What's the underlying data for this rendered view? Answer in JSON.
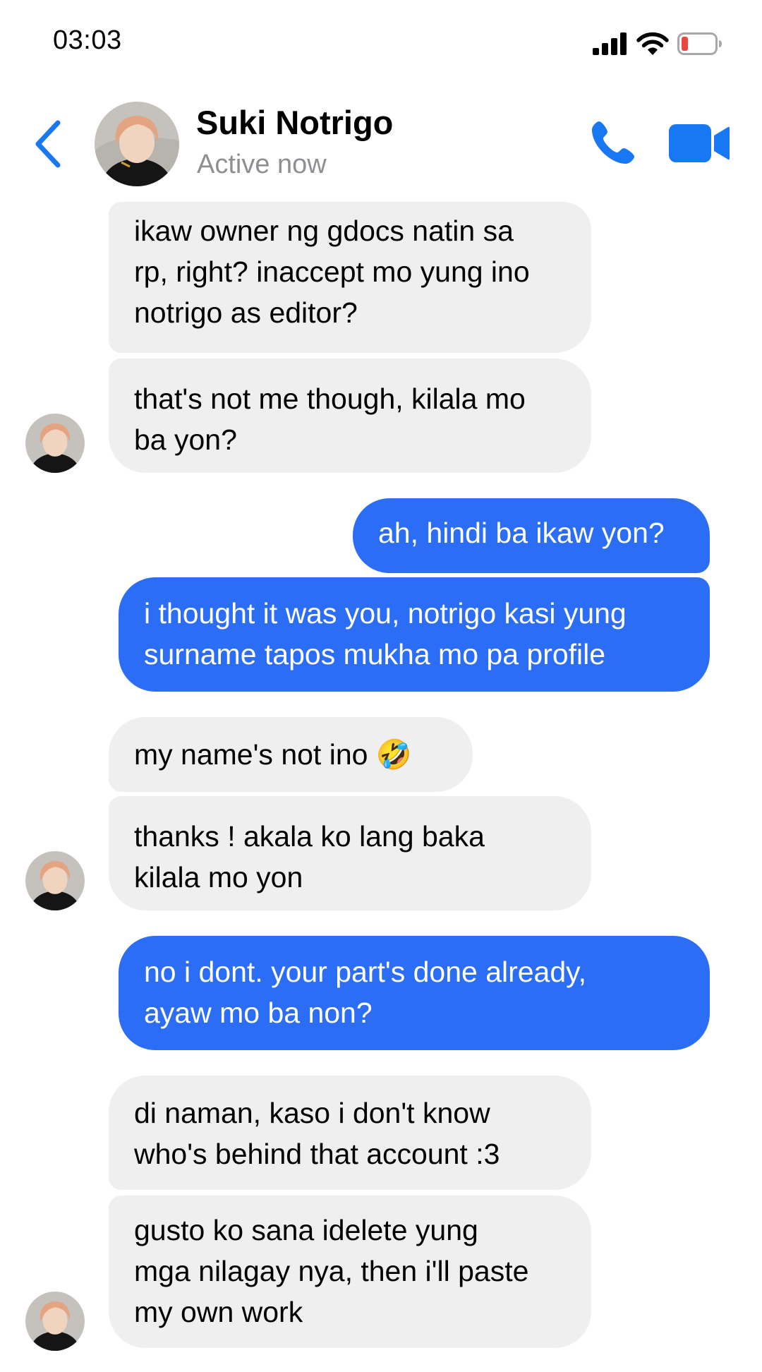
{
  "status_bar": {
    "time": "03:03",
    "icons": [
      "signal-icon",
      "wifi-icon",
      "battery-low-icon"
    ]
  },
  "header": {
    "back_icon": "chevron-left-icon",
    "contact_name": "Suki Notrigo",
    "contact_status": "Active now",
    "call_icon": "phone-icon",
    "video_icon": "video-camera-icon"
  },
  "colors": {
    "accent": "#1877F2",
    "outgoing_bubble": "#2C6DF5",
    "incoming_bubble": "#EFEFEF",
    "secondary_text": "#8E8E93",
    "battery_low": "#E9473F"
  },
  "messages": [
    {
      "direction": "incoming",
      "text": "ikaw owner ng gdocs natin sa\nrp, right? inaccept mo yung ino\nnotrigo as editor?"
    },
    {
      "direction": "incoming",
      "text": "that's not me though, kilala mo\nba yon?"
    },
    {
      "direction": "outgoing",
      "text": "ah, hindi ba ikaw yon?"
    },
    {
      "direction": "outgoing",
      "text": "i thought it was you, notrigo kasi yung\nsurname tapos mukha mo pa profile"
    },
    {
      "direction": "incoming",
      "text": "my name's not ino 🤣"
    },
    {
      "direction": "incoming",
      "text": "thanks ! akala ko lang baka\nkilala mo yon"
    },
    {
      "direction": "outgoing",
      "text": "no i dont. your part's done already,\nayaw mo ba non?"
    },
    {
      "direction": "incoming",
      "text": "di naman, kaso i don't know\nwho's behind that account :3"
    },
    {
      "direction": "incoming",
      "text": "gusto ko sana idelete yung\nmga nilagay nya, then i'll paste\nmy own work"
    }
  ]
}
